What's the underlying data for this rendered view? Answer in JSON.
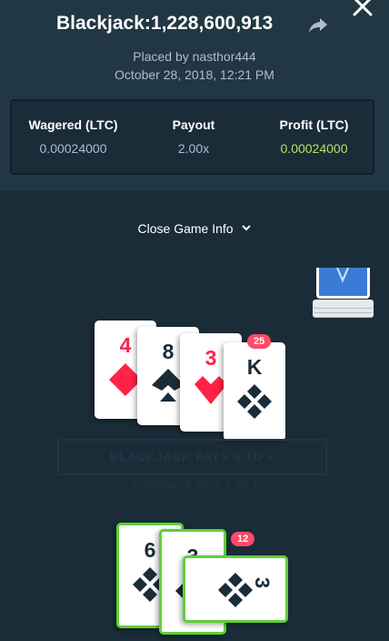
{
  "header": {
    "title": "Blackjack:1,228,600,913",
    "placed_by": "Placed by nasthor444",
    "date": "October 28, 2018, 12:21 PM"
  },
  "stats": {
    "wagered_label": "Wagered (LTC)",
    "wagered_value": "0.00024000",
    "payout_label": "Payout",
    "payout_value": "2.00x",
    "profit_label": "Profit (LTC)",
    "profit_value": "0.00024000"
  },
  "toggle_label": "Close Game Info",
  "dealer": {
    "total": "25",
    "cards": [
      {
        "rank": "4",
        "suit": "diamond",
        "color": "red"
      },
      {
        "rank": "8",
        "suit": "spade",
        "color": "dark"
      },
      {
        "rank": "3",
        "suit": "heart",
        "color": "red"
      },
      {
        "rank": "K",
        "suit": "club",
        "color": "dark"
      }
    ]
  },
  "table": {
    "banner": "BLACKJACK PAYS 3 TO 2",
    "subbanner": "INSURANCE PAYS 2 TO 1"
  },
  "player": {
    "total": "12",
    "cards": [
      {
        "rank": "6",
        "suit": "club",
        "color": "dark"
      },
      {
        "rank": "3",
        "suit": "club",
        "color": "dark"
      },
      {
        "rank": "3",
        "suit": "diamond",
        "color": "dark"
      }
    ]
  },
  "colors": {
    "accent_green": "#5ed039",
    "profit_green": "#b4e35a",
    "red_suit": "#fe2247",
    "badge": "#ff4a68"
  }
}
